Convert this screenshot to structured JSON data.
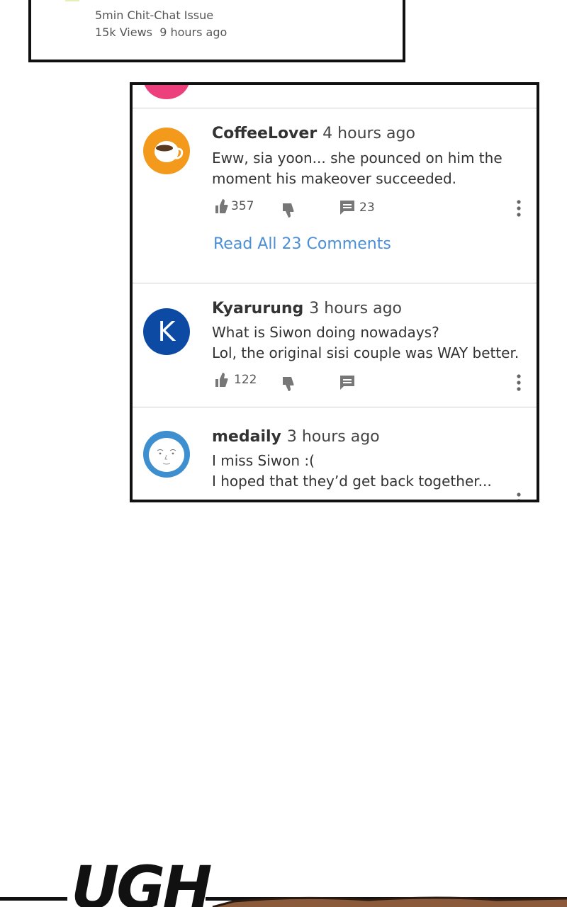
{
  "article": {
    "category_line": "5min Chit-Chat Issue",
    "views": "15k Views",
    "time": "9 hours ago"
  },
  "comments": [
    {
      "user": "CoffeeLover",
      "time": "4 hours ago",
      "lines": [
        "Eww, sia yoon... she pounced on him the",
        "moment his makeover succeeded."
      ],
      "likes": "357",
      "replies": "23",
      "read_all": "Read All 23 Comments",
      "avatar": "coffee-cup-icon"
    },
    {
      "user": "Kyarurung",
      "time": "3 hours ago",
      "lines": [
        "What is Siwon doing nowadays?",
        "Lol, the original sisi couple was WAY better."
      ],
      "likes": "122",
      "replies": "",
      "avatar_letter": "K"
    },
    {
      "user": "medaily",
      "time": "3 hours ago",
      "lines": [
        "I miss Siwon :(",
        "I hoped that they’d get back together..."
      ],
      "avatar": "face-sketch-icon"
    }
  ],
  "sfx": "UGH",
  "colors": {
    "link": "#4a8fd6",
    "avatar_pink": "#ec3f7c",
    "avatar_orange": "#f39a1c",
    "avatar_navy": "#0c4aa4",
    "avatar_blue": "#3d8fcf"
  }
}
